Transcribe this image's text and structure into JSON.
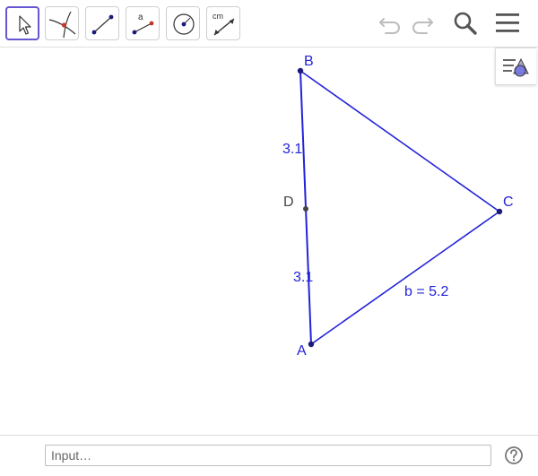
{
  "toolbar": {
    "tools": [
      {
        "name": "move",
        "icon": "move-arrow-icon",
        "selected": true
      },
      {
        "name": "intersect",
        "icon": "intersect-icon"
      },
      {
        "name": "segment",
        "icon": "segment-icon"
      },
      {
        "name": "segment-with-length",
        "icon": "segment-length-icon",
        "label": "a"
      },
      {
        "name": "circle-with-center",
        "icon": "circle-center-icon"
      },
      {
        "name": "distance",
        "icon": "distance-length-icon",
        "label": "cm"
      }
    ],
    "undo_icon": "undo-icon",
    "redo_icon": "redo-icon",
    "search_icon": "search-icon",
    "menu_icon": "menu-icon"
  },
  "algebra_toggle_icon": "algebra-view-icon",
  "graphics": {
    "points": [
      {
        "name": "A",
        "label": "A"
      },
      {
        "name": "B",
        "label": "B"
      },
      {
        "name": "C",
        "label": "C"
      },
      {
        "name": "D",
        "label": "D"
      }
    ],
    "segment_labels": {
      "bd": "3.1",
      "da": "3.1",
      "ac": "b = 5.2"
    }
  },
  "input_bar": {
    "placeholder": "Input…",
    "help_icon": "help-icon"
  },
  "colors": {
    "object_blue": "#2323d8",
    "point_dark": "#1b1b7a",
    "midpoint": "#444444",
    "tool_selected_border": "#6557d2",
    "icon_gray": "#555555",
    "disabled_gray": "#bdbdbd"
  }
}
